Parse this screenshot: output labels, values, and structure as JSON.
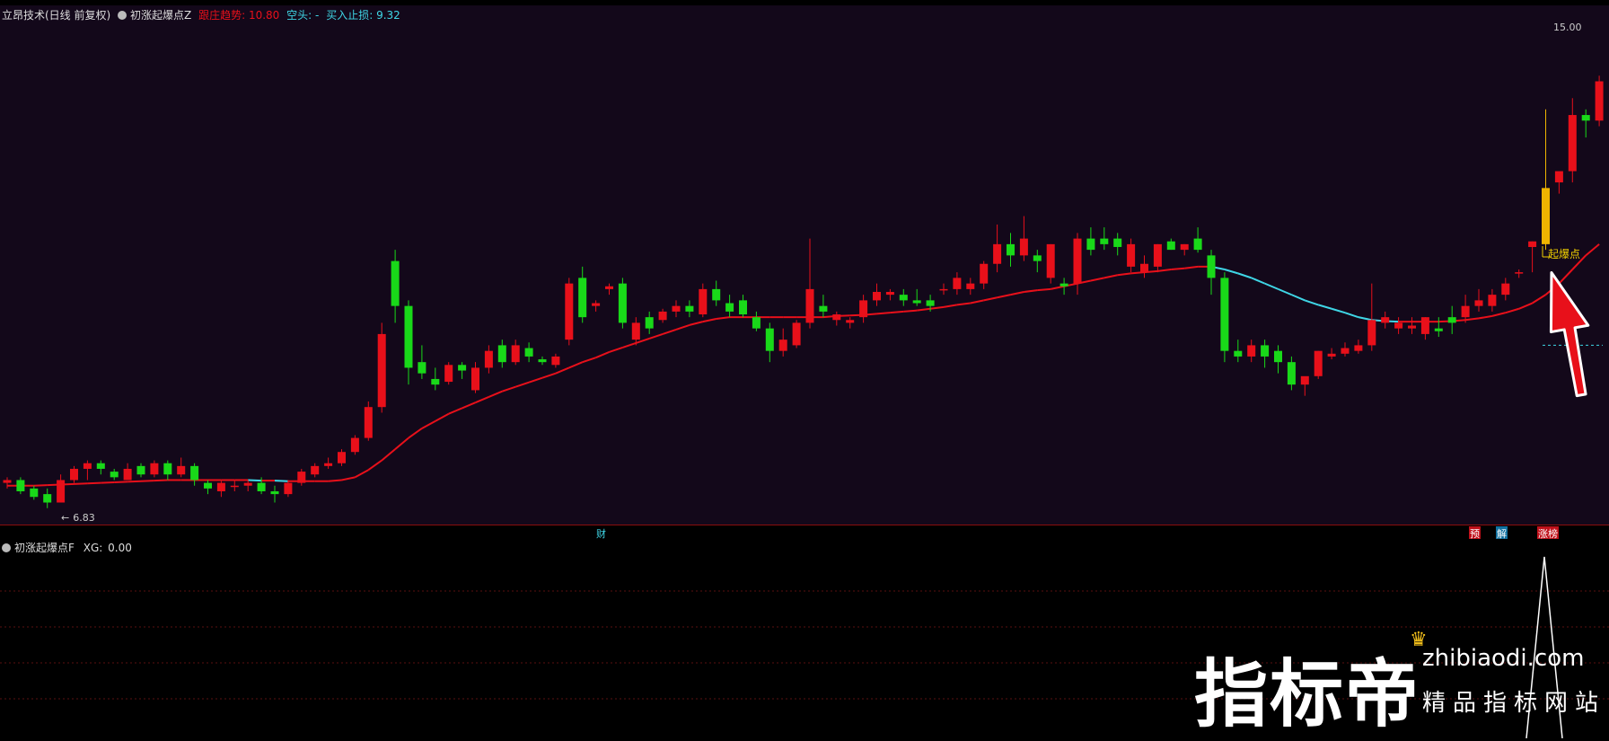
{
  "header": {
    "title": "立昂技术(日线 前复权)",
    "indicator_name": "初涨起爆点Z",
    "trend_label": "跟庄趋势:",
    "trend_value": "10.80",
    "short_label": "空头:",
    "short_value": "-",
    "stop_label": "买入止损:",
    "stop_value": "9.32"
  },
  "lower_header": {
    "indicator_name": "初涨起爆点F",
    "xg_label": "XG:",
    "xg_value": "0.00"
  },
  "annotations": {
    "price_high": "15.00",
    "price_low": "6.83",
    "signal_label": "起爆点",
    "marker_cai": "财",
    "marker_yu": "预",
    "marker_jie": "解",
    "marker_zhangting": "涨榜"
  },
  "watermark": {
    "brand": "指标帝",
    "site": "zhibiaodi.com",
    "slogan": "精品指标网站"
  },
  "colors": {
    "up": "#e8101a",
    "down": "#19d919",
    "ma_up": "#e8101a",
    "ma_down": "#3fd6e6",
    "signal": "#f0b400",
    "background": "#13081a"
  },
  "chart_data": {
    "type": "candlestick",
    "ylim": [
      6.5,
      15.2
    ],
    "ohlc": [
      [
        7.05,
        7.15,
        6.95,
        7.1
      ],
      [
        7.1,
        7.15,
        6.85,
        6.9
      ],
      [
        6.95,
        7.0,
        6.75,
        6.8
      ],
      [
        6.85,
        6.95,
        6.6,
        6.7
      ],
      [
        6.7,
        7.2,
        6.7,
        7.1
      ],
      [
        7.1,
        7.35,
        7.05,
        7.3
      ],
      [
        7.3,
        7.45,
        7.1,
        7.4
      ],
      [
        7.4,
        7.45,
        7.2,
        7.3
      ],
      [
        7.25,
        7.3,
        7.1,
        7.15
      ],
      [
        7.1,
        7.4,
        7.1,
        7.3
      ],
      [
        7.35,
        7.4,
        7.15,
        7.2
      ],
      [
        7.2,
        7.45,
        7.15,
        7.4
      ],
      [
        7.4,
        7.45,
        7.1,
        7.2
      ],
      [
        7.2,
        7.5,
        7.15,
        7.35
      ],
      [
        7.35,
        7.4,
        7.0,
        7.1
      ],
      [
        7.05,
        7.1,
        6.85,
        6.95
      ],
      [
        6.9,
        7.1,
        6.8,
        7.05
      ],
      [
        7.0,
        7.1,
        6.9,
        7.0
      ],
      [
        7.0,
        7.1,
        6.9,
        7.05
      ],
      [
        7.05,
        7.15,
        6.85,
        6.9
      ],
      [
        6.9,
        7.0,
        6.7,
        6.85
      ],
      [
        6.85,
        7.1,
        6.8,
        7.05
      ],
      [
        7.05,
        7.3,
        7.0,
        7.25
      ],
      [
        7.2,
        7.4,
        7.15,
        7.35
      ],
      [
        7.35,
        7.5,
        7.3,
        7.4
      ],
      [
        7.4,
        7.65,
        7.35,
        7.6
      ],
      [
        7.6,
        7.9,
        7.55,
        7.85
      ],
      [
        7.85,
        8.5,
        7.8,
        8.4
      ],
      [
        8.4,
        9.9,
        8.3,
        9.7
      ],
      [
        11.0,
        11.2,
        9.9,
        10.2
      ],
      [
        10.2,
        10.3,
        8.8,
        9.1
      ],
      [
        9.2,
        9.5,
        8.9,
        9.0
      ],
      [
        8.9,
        9.1,
        8.7,
        8.8
      ],
      [
        8.85,
        9.2,
        8.8,
        9.15
      ],
      [
        9.15,
        9.2,
        8.9,
        9.05
      ],
      [
        8.7,
        9.2,
        8.65,
        9.1
      ],
      [
        9.1,
        9.5,
        9.0,
        9.4
      ],
      [
        9.5,
        9.6,
        9.1,
        9.2
      ],
      [
        9.2,
        9.6,
        9.15,
        9.5
      ],
      [
        9.45,
        9.55,
        9.2,
        9.3
      ],
      [
        9.25,
        9.3,
        9.15,
        9.2
      ],
      [
        9.15,
        9.35,
        9.1,
        9.3
      ],
      [
        9.6,
        10.7,
        9.5,
        10.6
      ],
      [
        10.7,
        10.9,
        9.9,
        10.0
      ],
      [
        10.2,
        10.3,
        10.1,
        10.25
      ],
      [
        10.5,
        10.6,
        10.4,
        10.55
      ],
      [
        10.6,
        10.7,
        9.8,
        9.9
      ],
      [
        9.6,
        10.0,
        9.5,
        9.9
      ],
      [
        10.0,
        10.1,
        9.7,
        9.8
      ],
      [
        9.95,
        10.15,
        9.9,
        10.1
      ],
      [
        10.1,
        10.3,
        10.0,
        10.2
      ],
      [
        10.2,
        10.3,
        10.0,
        10.1
      ],
      [
        10.05,
        10.6,
        10.0,
        10.5
      ],
      [
        10.5,
        10.65,
        10.2,
        10.3
      ],
      [
        10.25,
        10.4,
        10.0,
        10.1
      ],
      [
        10.3,
        10.4,
        10.0,
        10.05
      ],
      [
        10.0,
        10.1,
        9.75,
        9.8
      ],
      [
        9.8,
        9.9,
        9.2,
        9.4
      ],
      [
        9.4,
        9.8,
        9.3,
        9.6
      ],
      [
        9.5,
        9.95,
        9.45,
        9.9
      ],
      [
        9.9,
        11.4,
        9.8,
        10.5
      ],
      [
        10.2,
        10.4,
        10.0,
        10.1
      ],
      [
        9.95,
        10.1,
        9.85,
        10.05
      ],
      [
        9.9,
        10.0,
        9.8,
        9.95
      ],
      [
        10.0,
        10.4,
        9.9,
        10.3
      ],
      [
        10.3,
        10.6,
        10.2,
        10.45
      ],
      [
        10.4,
        10.5,
        10.3,
        10.45
      ],
      [
        10.4,
        10.5,
        10.2,
        10.3
      ],
      [
        10.3,
        10.5,
        10.2,
        10.25
      ],
      [
        10.3,
        10.4,
        10.1,
        10.2
      ],
      [
        10.5,
        10.6,
        10.4,
        10.5
      ],
      [
        10.5,
        10.8,
        10.4,
        10.7
      ],
      [
        10.5,
        10.7,
        10.4,
        10.6
      ],
      [
        10.6,
        11.0,
        10.5,
        10.95
      ],
      [
        10.95,
        11.65,
        10.8,
        11.3
      ],
      [
        11.3,
        11.5,
        10.9,
        11.1
      ],
      [
        11.1,
        11.8,
        11.0,
        11.4
      ],
      [
        11.1,
        11.2,
        10.8,
        11.0
      ],
      [
        10.7,
        11.3,
        10.6,
        11.3
      ],
      [
        10.6,
        10.7,
        10.4,
        10.55
      ],
      [
        10.6,
        11.5,
        10.4,
        11.4
      ],
      [
        11.4,
        11.6,
        11.1,
        11.2
      ],
      [
        11.4,
        11.6,
        11.2,
        11.3
      ],
      [
        11.4,
        11.5,
        11.1,
        11.25
      ],
      [
        10.9,
        11.4,
        10.8,
        11.3
      ],
      [
        10.8,
        11.1,
        10.7,
        10.95
      ],
      [
        10.9,
        11.3,
        10.8,
        11.3
      ],
      [
        11.35,
        11.4,
        11.2,
        11.2
      ],
      [
        11.2,
        11.3,
        11.1,
        11.3
      ],
      [
        11.4,
        11.6,
        11.15,
        11.2
      ],
      [
        11.1,
        11.2,
        10.4,
        10.7
      ],
      [
        10.7,
        10.8,
        9.2,
        9.4
      ],
      [
        9.4,
        9.6,
        9.2,
        9.3
      ],
      [
        9.3,
        9.6,
        9.2,
        9.5
      ],
      [
        9.5,
        9.6,
        9.1,
        9.3
      ],
      [
        9.4,
        9.5,
        9.0,
        9.2
      ],
      [
        9.2,
        9.3,
        8.7,
        8.8
      ],
      [
        8.8,
        8.9,
        8.6,
        8.95
      ],
      [
        8.95,
        9.4,
        8.9,
        9.4
      ],
      [
        9.3,
        9.45,
        9.25,
        9.35
      ],
      [
        9.35,
        9.55,
        9.3,
        9.45
      ],
      [
        9.4,
        9.6,
        9.35,
        9.5
      ],
      [
        9.5,
        10.6,
        9.4,
        9.95
      ],
      [
        9.9,
        10.1,
        9.8,
        10.0
      ],
      [
        9.8,
        10.0,
        9.7,
        9.9
      ],
      [
        9.8,
        10.0,
        9.7,
        9.85
      ],
      [
        9.7,
        10.0,
        9.6,
        10.0
      ],
      [
        9.8,
        10.0,
        9.65,
        9.75
      ],
      [
        10.0,
        10.2,
        9.7,
        9.9
      ],
      [
        10.0,
        10.4,
        9.9,
        10.2
      ],
      [
        10.2,
        10.5,
        10.1,
        10.3
      ],
      [
        10.2,
        10.5,
        10.1,
        10.4
      ],
      [
        10.4,
        10.7,
        10.3,
        10.6
      ],
      [
        10.8,
        10.85,
        10.7,
        10.8
      ],
      [
        11.25,
        11.35,
        10.8,
        11.35
      ],
      [
        11.3,
        13.7,
        11.2,
        12.3
      ],
      [
        12.4,
        12.5,
        12.2,
        12.6
      ],
      [
        12.6,
        13.9,
        12.4,
        13.6
      ],
      [
        13.6,
        13.7,
        13.2,
        13.5
      ],
      [
        13.5,
        14.3,
        13.4,
        14.2
      ]
    ],
    "ma_values": [
      7.0,
      7.0,
      7.0,
      7.01,
      7.02,
      7.03,
      7.04,
      7.05,
      7.06,
      7.07,
      7.08,
      7.09,
      7.1,
      7.1,
      7.1,
      7.1,
      7.1,
      7.1,
      7.1,
      7.09,
      7.09,
      7.08,
      7.08,
      7.08,
      7.08,
      7.1,
      7.15,
      7.28,
      7.45,
      7.65,
      7.85,
      8.02,
      8.15,
      8.28,
      8.38,
      8.48,
      8.58,
      8.68,
      8.76,
      8.84,
      8.92,
      9.0,
      9.1,
      9.2,
      9.28,
      9.38,
      9.46,
      9.54,
      9.62,
      9.7,
      9.78,
      9.86,
      9.92,
      9.97,
      10.0,
      10.0,
      10.0,
      10.0,
      10.0,
      10.0,
      10.0,
      10.0,
      10.02,
      10.03,
      10.04,
      10.06,
      10.08,
      10.1,
      10.12,
      10.15,
      10.18,
      10.22,
      10.25,
      10.3,
      10.35,
      10.4,
      10.45,
      10.48,
      10.5,
      10.55,
      10.6,
      10.65,
      10.7,
      10.75,
      10.78,
      10.8,
      10.82,
      10.85,
      10.87,
      10.9,
      10.9,
      10.85,
      10.78,
      10.7,
      10.6,
      10.5,
      10.4,
      10.3,
      10.22,
      10.15,
      10.08,
      10.0,
      9.95,
      9.93,
      9.92,
      9.92,
      9.92,
      9.92,
      9.93,
      9.95,
      9.98,
      10.02,
      10.08,
      10.15,
      10.25,
      10.4,
      10.6,
      10.85,
      11.1,
      11.3
    ]
  }
}
